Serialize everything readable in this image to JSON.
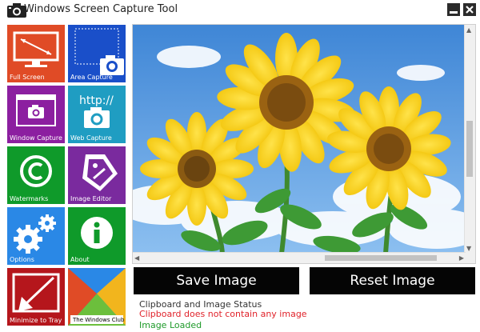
{
  "window": {
    "title": "Windows Screen Capture Tool",
    "controls": [
      "minimize",
      "close"
    ]
  },
  "tiles": [
    {
      "label": "Full Screen",
      "color": "#e04b26",
      "icon": "monitor-icon"
    },
    {
      "label": "Area Capture",
      "color": "#1a4fc9",
      "icon": "camera-icon"
    },
    {
      "label": "Window Capture",
      "color": "#8c1fa0",
      "icon": "window-camera-icon"
    },
    {
      "label": "Web Capture",
      "color": "#1f9dc2",
      "icon": "web-camera-icon"
    },
    {
      "label": "Watermarks",
      "color": "#0f9a2a",
      "icon": "copyright-icon"
    },
    {
      "label": "Image Editor",
      "color": "#7a2a9e",
      "icon": "tag-icon"
    },
    {
      "label": "Options",
      "color": "#2a88e6",
      "icon": "gears-icon"
    },
    {
      "label": "About",
      "color": "#0f9a2a",
      "icon": "info-icon"
    },
    {
      "label": "Minimize to Tray",
      "color": "#b5161c",
      "icon": "tray-arrow-icon"
    },
    {
      "label": "The Windows Club",
      "color": "#2a88e6",
      "icon": "windows-club-logo"
    }
  ],
  "web_capture_text": "http://",
  "buttons": {
    "save": "Save Image",
    "reset": "Reset Image"
  },
  "status": {
    "title": "Clipboard and Image Status",
    "line1": "Clipboard does not contain any image",
    "line2": "Image Loaded",
    "line1_color": "#e0222a",
    "line2_color": "#1f9a2a"
  },
  "preview": {
    "image_subject": "sunflowers-photo"
  }
}
